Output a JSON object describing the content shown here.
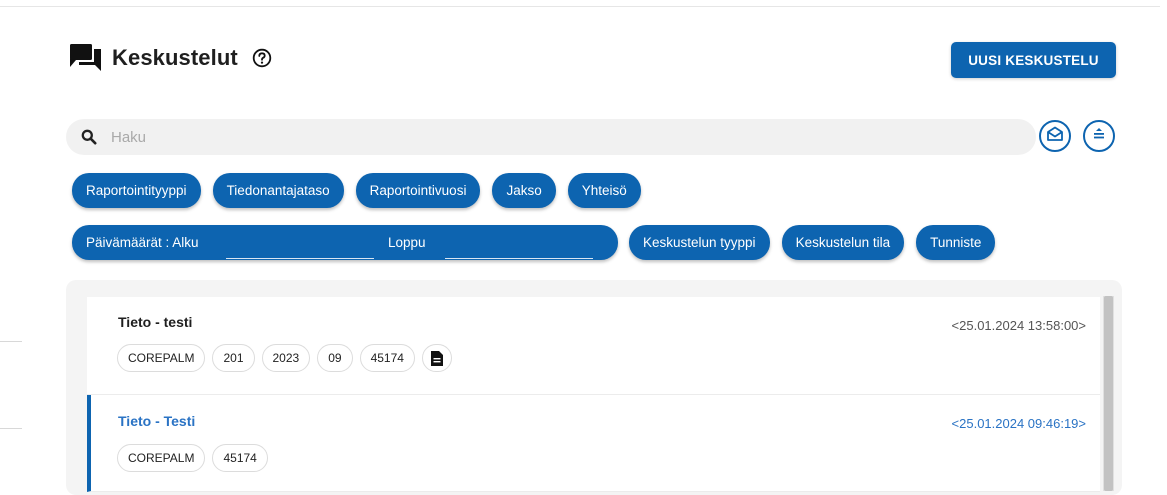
{
  "header": {
    "title": "Keskustelut",
    "new_button": "UUSI KESKUSTELU"
  },
  "search": {
    "placeholder": "Haku"
  },
  "filters": {
    "row1": [
      "Raportointityyppi",
      "Tiedonantajataso",
      "Raportointivuosi",
      "Jakso",
      "Yhteisö"
    ],
    "date_label": "Päivämäärät : Alku",
    "date_end_label": "Loppu",
    "row2": [
      "Keskustelun tyyppi",
      "Keskustelun tila",
      "Tunniste"
    ]
  },
  "conversations": [
    {
      "title": "Tieto - testi",
      "timestamp": "<25.01.2024 13:58:00>",
      "tags": [
        "COREPALM",
        "201",
        "2023",
        "09",
        "45174"
      ],
      "has_document": true,
      "selected": false
    },
    {
      "title": "Tieto - Testi",
      "timestamp": "<25.01.2024 09:46:19>",
      "tags": [
        "COREPALM",
        "45174"
      ],
      "has_document": false,
      "selected": true
    }
  ],
  "icons": {
    "title": "chat-icon",
    "help": "help-icon",
    "search": "search-icon",
    "mail": "mail-open-icon",
    "sort": "sort-icon",
    "document": "document-icon"
  },
  "colors": {
    "primary": "#0d64b0",
    "selected_text": "#2a73c4"
  }
}
